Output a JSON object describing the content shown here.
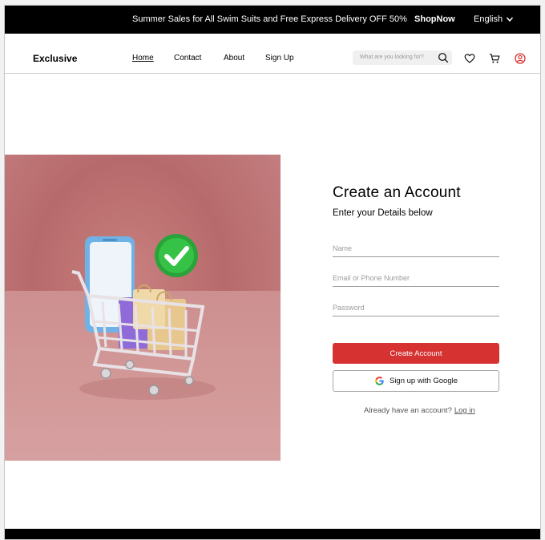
{
  "topbar": {
    "promo_text": "Summer Sales for All Swim Suits and Free Express Delivery OFF 50%",
    "promo_link": "ShopNow",
    "language": "English"
  },
  "header": {
    "logo": "Exclusive",
    "nav": [
      "Home",
      "Contact",
      "About",
      "Sign Up"
    ],
    "search_placeholder": "What are you looking for?",
    "icons": [
      "search-icon",
      "heart-icon",
      "cart-icon",
      "user-icon"
    ]
  },
  "form": {
    "title": "Create an Account",
    "subtitle": "Enter your Details below",
    "name_placeholder": "Name",
    "email_placeholder": "Email or Phone Number",
    "password_placeholder": "Password",
    "create_button": "Create Account",
    "google_button": "Sign up with Google",
    "login_prompt": "Already have an account?",
    "login_link": "Log in"
  },
  "colors": {
    "accent": "#d63232",
    "topbar": "#000000",
    "hero_bg": "#b76a6b"
  }
}
